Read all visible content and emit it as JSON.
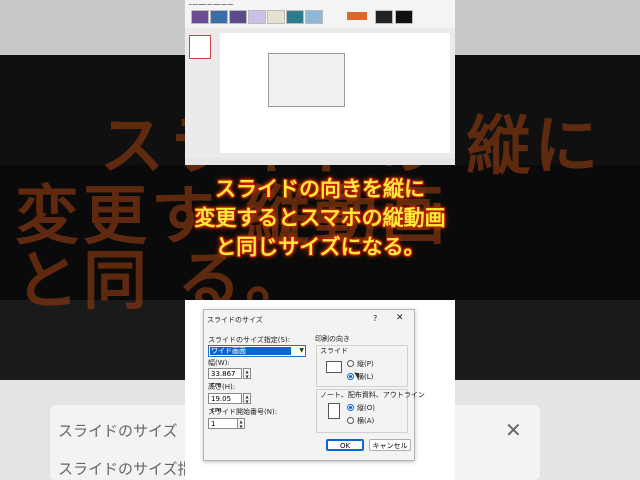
{
  "caption": {
    "lines": [
      "スライドの向きを縦に",
      "変更するとスマホの縦動画",
      "と同じサイズになる。"
    ],
    "text_color": "#ffea3c",
    "outline_color": "#c31c00"
  },
  "background": {
    "big_text_row1": "スライドの 縦に",
    "big_text_row2": "変更す 縦動画",
    "big_text_row3": "と同 る。",
    "dialog_title": "スライドのサイズ",
    "dialog_label": "スライドのサイズ指定"
  },
  "dialog": {
    "title": "スライドのサイズ",
    "help_icon": "?",
    "close_icon": "✕",
    "size_spec_label": "スライドのサイズ指定(S):",
    "size_spec_value": "ワイド画面",
    "width_label": "幅(W):",
    "width_value": "33.867 cm",
    "height_label": "高さ(H):",
    "height_value": "19.05 cm",
    "start_num_label": "スライド開始番号(N):",
    "start_num_value": "1",
    "orientation_label": "印刷の向き",
    "slide_group_label": "スライド",
    "slide_portrait": "縦(P)",
    "slide_landscape": "横(L)",
    "notes_group_label": "ノート、配布資料、アウトライン",
    "notes_portrait": "縦(O)",
    "notes_landscape": "横(A)",
    "ok_label": "OK",
    "cancel_label": "キャンセル",
    "accent_color": "#0a64d6"
  }
}
